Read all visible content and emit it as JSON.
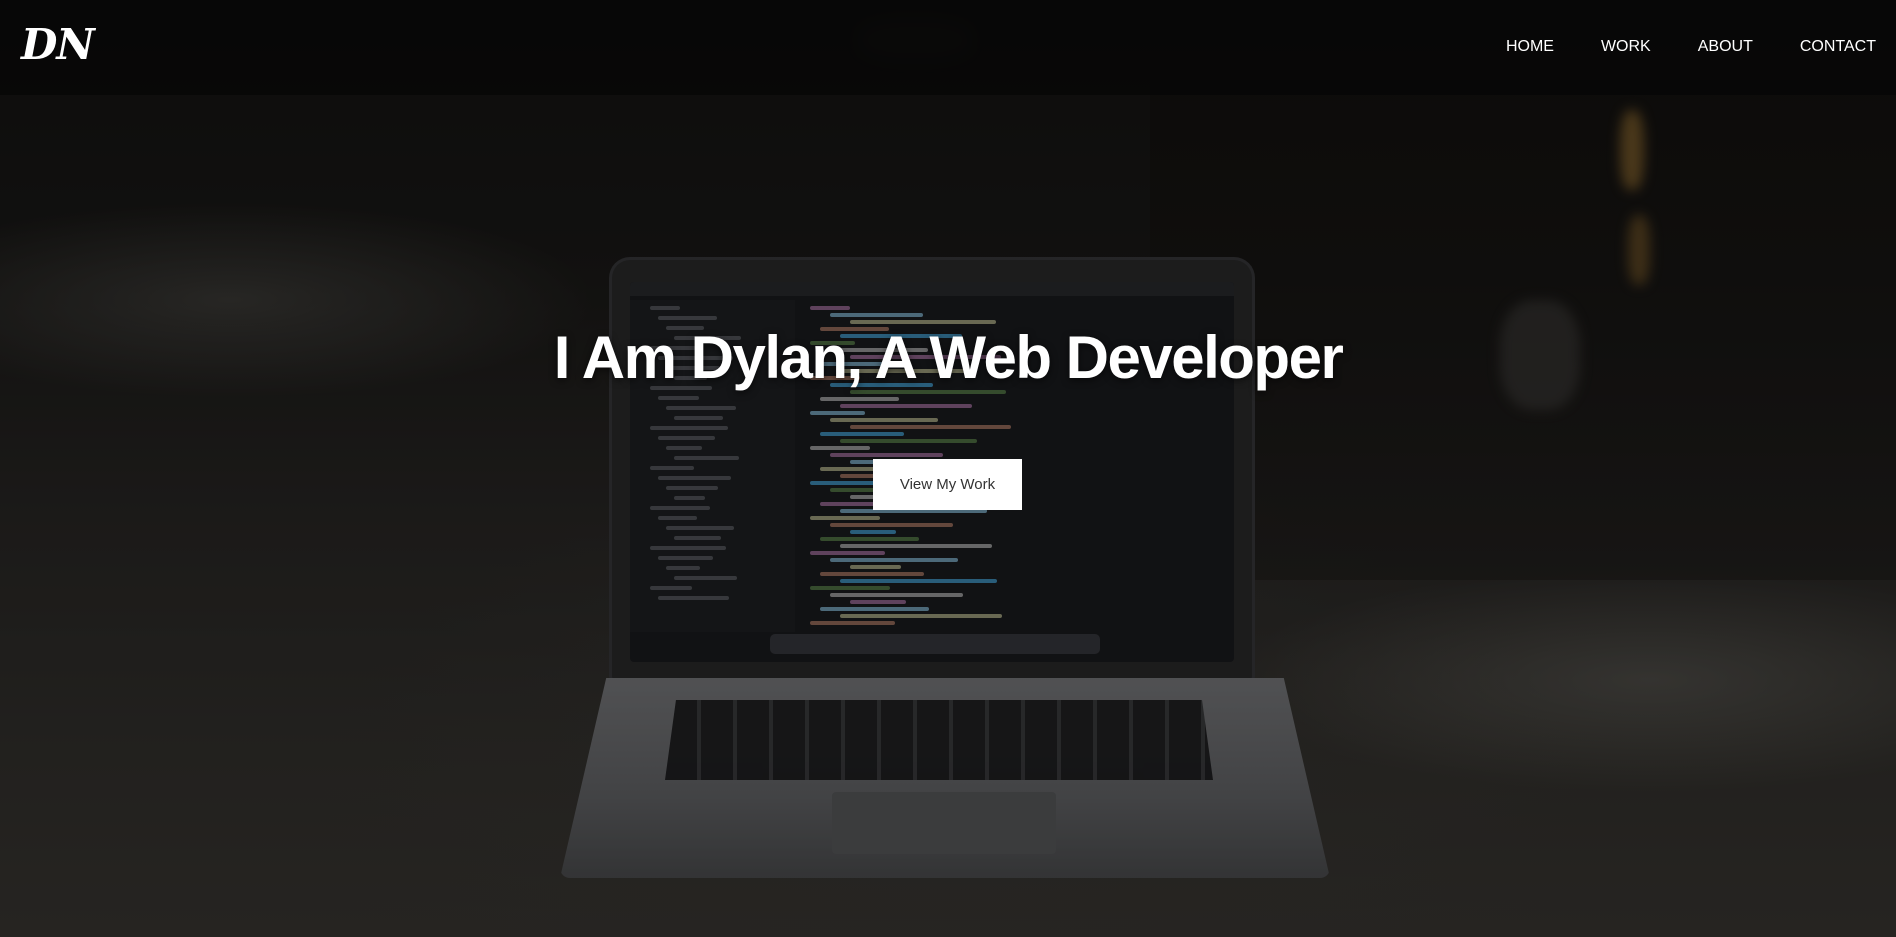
{
  "brand": {
    "logo_text": "DN"
  },
  "nav": {
    "items": [
      {
        "label": "HOME"
      },
      {
        "label": "WORK"
      },
      {
        "label": "ABOUT"
      },
      {
        "label": "CONTACT"
      }
    ]
  },
  "hero": {
    "title": "I Am Dylan, A Web Developer",
    "cta_label": "View My Work",
    "background_description_icon": "laptop-photo"
  },
  "colors": {
    "navbar_bg": "#080808",
    "text": "#ffffff",
    "button_bg": "#ffffff",
    "button_text": "#333333"
  }
}
